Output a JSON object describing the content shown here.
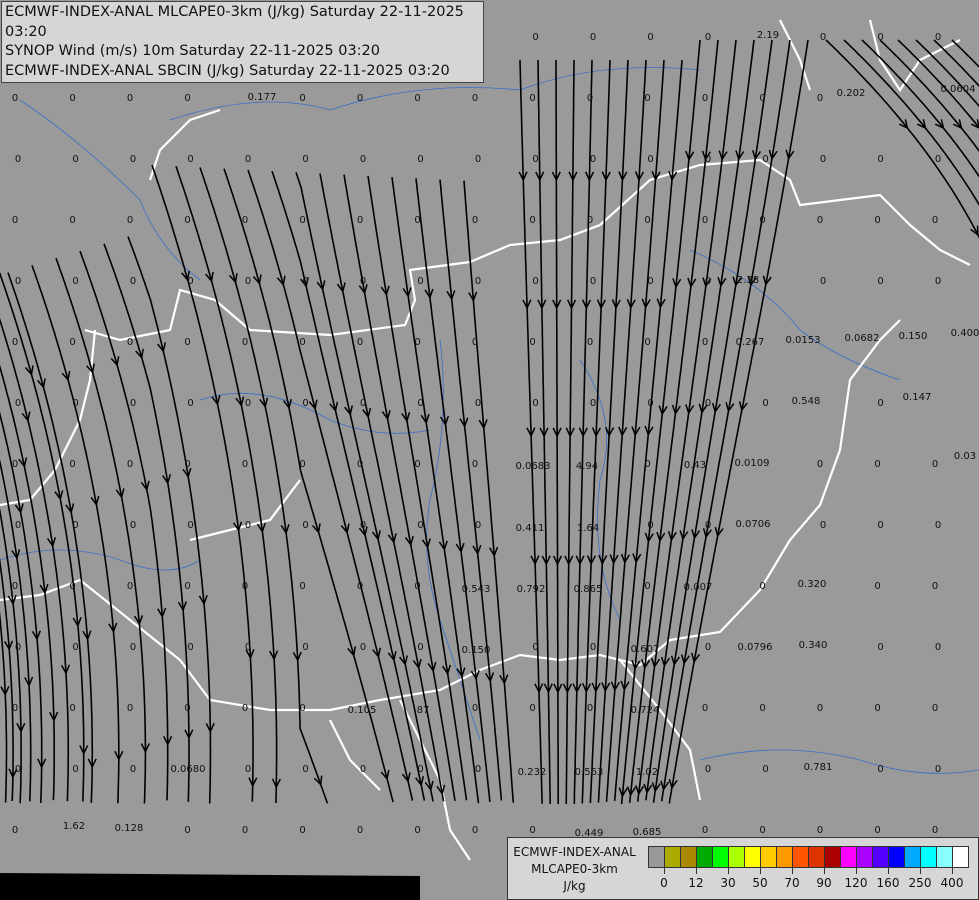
{
  "header": {
    "lines": [
      "ECMWF-INDEX-ANAL MLCAPE0-3km (J/kg) Saturday 22-11-2025 03:20",
      "SYNOP Wind (m/s) 10m Saturday 22-11-2025 03:20",
      "ECMWF-INDEX-ANAL SBCIN (J/kg) Saturday 22-11-2025 03:20"
    ]
  },
  "legend": {
    "title_lines": [
      "ECMWF-INDEX-ANAL",
      "MLCAPE0-3km",
      "J/kg"
    ],
    "colors": [
      "#999999",
      "#aaaa00",
      "#aa8800",
      "#00aa00",
      "#00ff00",
      "#aaff00",
      "#ffff00",
      "#ffcc00",
      "#ff9900",
      "#ff5500",
      "#dd3300",
      "#aa0000",
      "#ff00ff",
      "#aa00ff",
      "#5500ff",
      "#0000ff",
      "#00aaff",
      "#00ffff",
      "#88ffff",
      "#ffffff"
    ],
    "ticks": [
      "0",
      "12",
      "30",
      "50",
      "70",
      "90",
      "120",
      "160",
      "250",
      "400"
    ]
  },
  "map": {
    "background": "#9a9a9a",
    "border_color": "#ffffff",
    "river_color": "#3a6fc8",
    "zero_label": "0",
    "values": [
      "0.177",
      "2.19",
      "0.202",
      "0.0604",
      "2.38",
      "0.267",
      "0.0153",
      "0.0682",
      "0.150",
      "0.400",
      "0.147",
      "0.548",
      "0.0683",
      "4.94",
      "0.43",
      "0.0109",
      "0.03",
      "0.411",
      "1.64",
      "0.0706",
      "0.543",
      "0.792",
      "0.865",
      "0.007",
      "0.320",
      "0.150",
      "0.607",
      "0.0796",
      "0.340",
      "0.105",
      "87",
      "0.724",
      "0.0680",
      "0.232",
      "0.563",
      "1.02",
      "0.781",
      "1.62",
      "0.128",
      "0.449",
      "0.685"
    ]
  }
}
